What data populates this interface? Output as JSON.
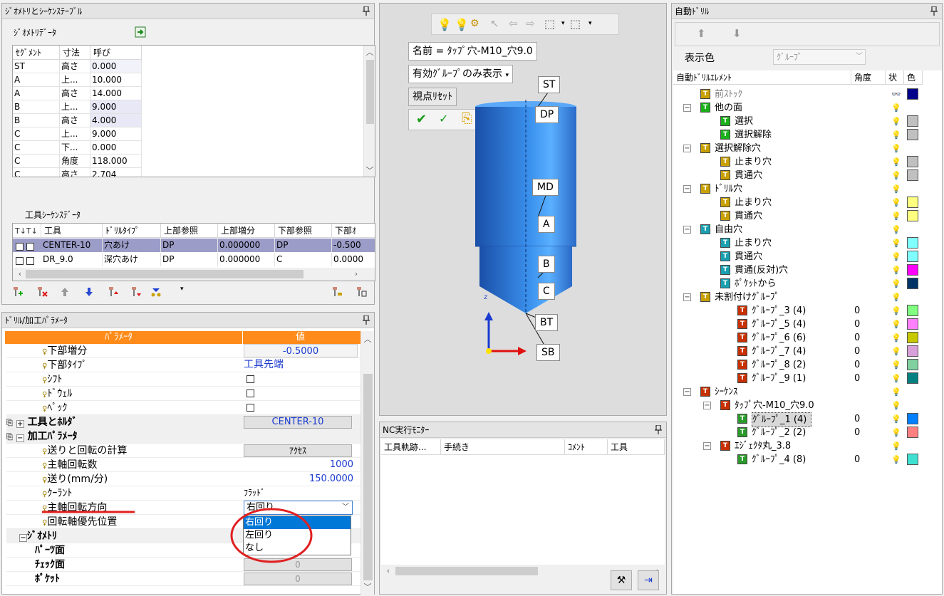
{
  "geometry_panel": {
    "title": "ｼﾞｵﾒﾄﾘとｼｰｹﾝｽﾃｰﾌﾞﾙ",
    "geometry_data_label": "ｼﾞｵﾒﾄﾘﾃﾞｰﾀ",
    "columns": [
      "ｾｸﾞﾒﾝﾄ",
      "寸法",
      "呼び"
    ],
    "rows": [
      [
        "ST",
        "高さ",
        "0.000"
      ],
      [
        "A",
        "上...",
        "10.000"
      ],
      [
        "A",
        "高さ",
        "14.000"
      ],
      [
        "B",
        "上...",
        "9.000"
      ],
      [
        "B",
        "高さ",
        "4.000"
      ],
      [
        "C",
        "上...",
        "9.000"
      ],
      [
        "C",
        "下...",
        "0.000"
      ],
      [
        "C",
        "角度",
        "118.000"
      ],
      [
        "C",
        "高さ",
        "2.704"
      ]
    ],
    "tool_sequence_label": "工具ｼｰｹﾝｽﾃﾞｰﾀ",
    "tool_columns": [
      "工具",
      "ﾄﾞﾘﾙﾀｲﾌﾟ",
      "上部参照",
      "上部増分",
      "下部参照",
      "下部ｵ"
    ],
    "tool_rows": [
      [
        "CENTER-10",
        "穴あけ",
        "DP",
        "0.000000",
        "DP",
        "-0.500"
      ],
      [
        "DR_9.0",
        "深穴あけ",
        "DP",
        "0.000000",
        "C",
        "0.0000"
      ]
    ]
  },
  "params_panel": {
    "title": "ﾄﾞﾘﾙ/加工ﾊﾟﾗﾒｰﾀ",
    "header_param": "ﾊﾟﾗﾒｰﾀ",
    "header_value": "値",
    "rows": [
      {
        "label": "下部増分",
        "value": "-0.5000"
      },
      {
        "label": "下部ﾀｲﾌﾟ",
        "value": "工具先端"
      },
      {
        "label": "ｼﾌﾄ",
        "value": ""
      },
      {
        "label": "ﾄﾞｳｪﾙ",
        "value": ""
      },
      {
        "label": "ﾍﾟｯｸ",
        "value": ""
      }
    ],
    "group_tool": "工具とﾎﾙﾀﾞ",
    "group_tool_value": "CENTER-10",
    "group_machining": "加工ﾊﾟﾗﾒｰﾀ",
    "feed_calc_label": "送りと回転の計算",
    "feed_calc_button": "ｱｸｾｽ",
    "spindle_speed_label": "主軸回転数",
    "spindle_speed_value": "1000",
    "feed_label": "送り(mm/分)",
    "feed_value": "150.0000",
    "coolant_label": "ｸｰﾗﾝﾄ",
    "coolant_value": "ﾌﾗｯﾄﾞ",
    "spindle_dir_label": "主軸回転方向",
    "spindle_dir_value": "右回り",
    "rotary_label": "回転軸優先位置",
    "group_geometry": "ｼﾞｵﾒﾄﾘ",
    "parts_face_label": "ﾊﾟｰﾂ面",
    "check_face_label": "ﾁｪｯｸ面",
    "check_face_value": "0",
    "pocket_label": "ﾎﾟｹｯﾄ",
    "pocket_value": "0",
    "dropdown_options": [
      "右回り",
      "左回り",
      "なし"
    ]
  },
  "viewer": {
    "name_label": "名前 = ﾀｯﾌﾟ穴-M10_穴9.0",
    "display_mode": "有効ｸﾞﾙｰﾌﾟのみ表示",
    "reset_view": "視点ﾘｾｯﾄ",
    "tags": [
      "ST",
      "DP",
      "MD",
      "A",
      "B",
      "C",
      "BT",
      "SB"
    ],
    "axis_label": "z"
  },
  "nc_monitor": {
    "title": "NC実行ﾓﾆﾀｰ",
    "columns": [
      "工具軌跡...",
      "手続き",
      "ｺﾒﾝﾄ",
      "工具"
    ]
  },
  "auto_drill": {
    "title": "自動ﾄﾞﾘﾙ",
    "display_color_label": "表示色",
    "display_color_value": "ｸﾞﾙｰﾌﾟ",
    "tree_header": [
      "自動ﾄﾞﾘﾙｴﾚﾒﾝﾄ",
      "角度",
      "状",
      "色"
    ],
    "items": [
      {
        "label": "前ｽﾄｯｸ",
        "angle": "",
        "color": "#00008b"
      },
      {
        "label": "他の面",
        "angle": "",
        "color": ""
      },
      {
        "label": "選択",
        "angle": "",
        "color": "#c0c0c0"
      },
      {
        "label": "選択解除",
        "angle": "",
        "color": "#c0c0c0"
      },
      {
        "label": "選択解除穴",
        "angle": "",
        "color": ""
      },
      {
        "label": "止まり穴",
        "angle": "",
        "color": "#c0c0c0"
      },
      {
        "label": "貫通穴",
        "angle": "",
        "color": "#c0c0c0"
      },
      {
        "label": "ﾄﾞﾘﾙ穴",
        "angle": "",
        "color": ""
      },
      {
        "label": "止まり穴",
        "angle": "",
        "color": "#ffff80"
      },
      {
        "label": "貫通穴",
        "angle": "",
        "color": "#ffff80"
      },
      {
        "label": "自由穴",
        "angle": "",
        "color": ""
      },
      {
        "label": "止まり穴",
        "angle": "",
        "color": "#80ffff"
      },
      {
        "label": "貫通穴",
        "angle": "",
        "color": "#80ffff"
      },
      {
        "label": "貫通(反対)穴",
        "angle": "",
        "color": "#ff00ff"
      },
      {
        "label": "ﾎﾟｹｯﾄから",
        "angle": "",
        "color": "#003366"
      },
      {
        "label": "未割付けｸﾞﾙｰﾌﾟ",
        "angle": "",
        "color": ""
      },
      {
        "label": "ｸﾞﾙｰﾌﾟ_3 (4)",
        "angle": "0",
        "color": "#80ff80"
      },
      {
        "label": "ｸﾞﾙｰﾌﾟ_5 (4)",
        "angle": "0",
        "color": "#ff80ff"
      },
      {
        "label": "ｸﾞﾙｰﾌﾟ_6 (6)",
        "angle": "0",
        "color": "#c8c800"
      },
      {
        "label": "ｸﾞﾙｰﾌﾟ_7 (4)",
        "angle": "0",
        "color": "#d8a0d8"
      },
      {
        "label": "ｸﾞﾙｰﾌﾟ_8 (2)",
        "angle": "0",
        "color": "#80d0a0"
      },
      {
        "label": "ｸﾞﾙｰﾌﾟ_9 (1)",
        "angle": "0",
        "color": "#008080"
      },
      {
        "label": "ｼｰｹﾝｽ",
        "angle": "",
        "color": ""
      },
      {
        "label": "ﾀｯﾌﾟ穴-M10_穴9.0",
        "angle": "",
        "color": ""
      },
      {
        "label": "ｸﾞﾙｰﾌﾟ_1 (4)",
        "angle": "0",
        "color": "#0080ff"
      },
      {
        "label": "ｸﾞﾙｰﾌﾟ_2 (2)",
        "angle": "0",
        "color": "#ff8080"
      },
      {
        "label": "ｴｼﾞｪｸﾀ丸_3.8",
        "angle": "",
        "color": ""
      },
      {
        "label": "ｸﾞﾙｰﾌﾟ_4 (8)",
        "angle": "0",
        "color": "#40e0d0"
      }
    ]
  },
  "colors": {
    "selection": "#9c9cc8",
    "header_orange": "#ff8c1a",
    "annotation_red": "#e02020",
    "tool_blue": "#2e7fd9"
  }
}
